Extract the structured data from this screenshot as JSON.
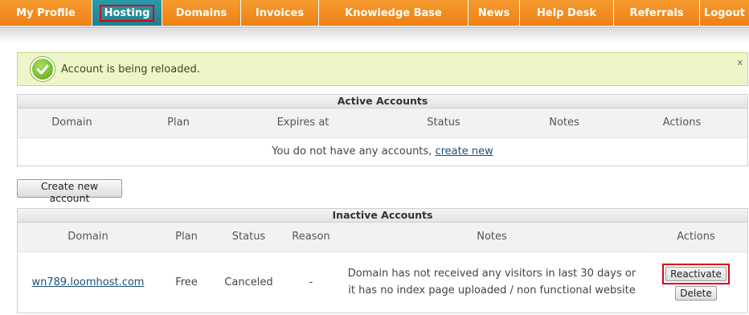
{
  "nav": {
    "items": [
      {
        "label": "My Profile",
        "active": false
      },
      {
        "label": "Hosting",
        "active": true
      },
      {
        "label": "Domains",
        "active": false
      },
      {
        "label": "Invoices",
        "active": false
      },
      {
        "label": "Knowledge Base",
        "active": false
      },
      {
        "label": "News",
        "active": false
      },
      {
        "label": "Help Desk",
        "active": false
      },
      {
        "label": "Referrals",
        "active": false
      },
      {
        "label": "Logout",
        "active": false
      }
    ]
  },
  "alert": {
    "message": "Account is being reloaded.",
    "close_label": "x",
    "icon": "checkmark-icon"
  },
  "active_accounts": {
    "title": "Active Accounts",
    "columns": [
      "Domain",
      "Plan",
      "Expires at",
      "Status",
      "Notes",
      "Actions"
    ],
    "empty_text": "You do not have any accounts, ",
    "empty_link": "create new"
  },
  "create_button_label": "Create new account",
  "inactive_accounts": {
    "title": "Inactive Accounts",
    "columns": [
      "Domain",
      "Plan",
      "Status",
      "Reason",
      "Notes",
      "Actions"
    ],
    "rows": [
      {
        "domain": "wn789.loomhost.com",
        "plan": "Free",
        "status": "Canceled",
        "reason": "-",
        "notes_line1": "Domain has not received any visitors in last 30 days or",
        "notes_line2": "it has no index page uploaded / non functional website",
        "reactivate_label": "Reactivate",
        "delete_label": "Delete"
      }
    ]
  },
  "colors": {
    "nav_orange": "#f28b1e",
    "nav_active": "#1d7f8c",
    "highlight_red": "#d9001b",
    "alert_bg": "#eef5c8"
  }
}
